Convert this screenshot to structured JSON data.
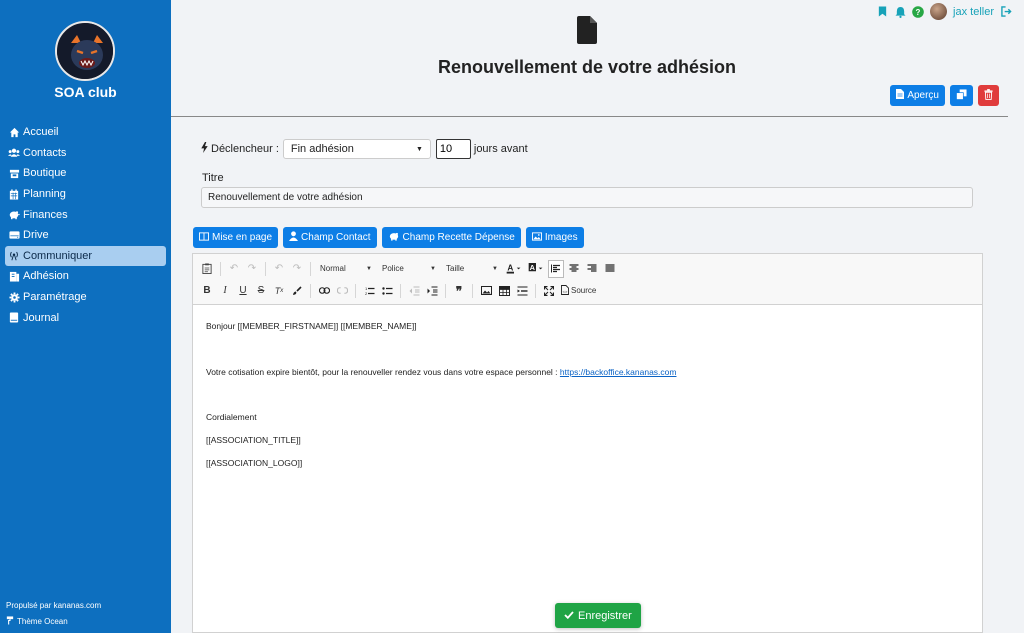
{
  "sidebar": {
    "club_name": "SOA club",
    "items": [
      {
        "label": "Accueil",
        "icon": "home-icon"
      },
      {
        "label": "Contacts",
        "icon": "users-icon"
      },
      {
        "label": "Boutique",
        "icon": "store-icon"
      },
      {
        "label": "Planning",
        "icon": "calendar-icon"
      },
      {
        "label": "Finances",
        "icon": "piggy-bank-icon"
      },
      {
        "label": "Drive",
        "icon": "drive-icon"
      },
      {
        "label": "Communiquer",
        "icon": "broadcast-icon",
        "active": true
      },
      {
        "label": "Adhésion",
        "icon": "id-card-icon"
      },
      {
        "label": "Paramétrage",
        "icon": "gear-icon"
      },
      {
        "label": "Journal",
        "icon": "book-icon"
      }
    ],
    "footer_powered": "Propulsé par kananas.com",
    "footer_theme": "Thème Ocean"
  },
  "topbar": {
    "username": "jax teller"
  },
  "header": {
    "title": "Renouvellement de votre adhésion",
    "preview_label": "Aperçu"
  },
  "form": {
    "trigger_label": "Déclencheur :",
    "trigger_value": "Fin adhésion",
    "days_value": "10",
    "days_suffix": "jours avant",
    "title_label": "Titre",
    "title_value": "Renouvellement de votre adhésion"
  },
  "insert_buttons": {
    "layout": "Mise en page",
    "contact": "Champ Contact",
    "recette": "Champ Recette Dépense",
    "images": "Images"
  },
  "toolbar": {
    "format": "Normal",
    "font": "Police",
    "size": "Taille",
    "source": "Source"
  },
  "editor": {
    "greeting": "Bonjour [[MEMBER_FIRSTNAME]] [[MEMBER_NAME]]",
    "body_text": "Votre cotisation expire bientôt, pour la renouveller rendez vous dans votre espace personnel : ",
    "link": "https://backoffice.kananas.com",
    "closing": "Cordialement",
    "assoc_title": "[[ASSOCIATION_TITLE]]",
    "assoc_logo": "[[ASSOCIATION_LOGO]]"
  },
  "save_label": "Enregistrer",
  "colors": {
    "sidebar": "#0d6fbf",
    "primary": "#0d7ee6",
    "danger": "#e03c3c",
    "success": "#1fa445",
    "accent": "#17a2b8"
  }
}
